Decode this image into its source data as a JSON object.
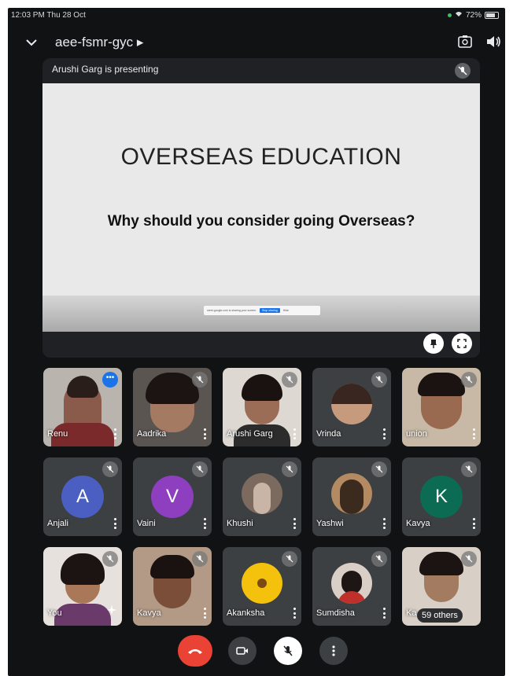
{
  "status": {
    "time": "12:03 PM  Thu 28 Oct",
    "battery": "72%"
  },
  "meeting": {
    "code": "aee-fsmr-gyc ▸"
  },
  "presentation": {
    "presenter_text": "Arushi Garg is presenting",
    "slide_title": "OVERSEAS  EDUCATION",
    "slide_subtitle": "Why should you consider going Overseas?",
    "share_bar": {
      "message": "meet.google.com is sharing your screen.",
      "stop_label": "Stop sharing",
      "hide_label": "Hide"
    }
  },
  "participants": [
    {
      "name": "Renu"
    },
    {
      "name": "Aadrika"
    },
    {
      "name": "Arushi Garg"
    },
    {
      "name": "Vrinda"
    },
    {
      "name": "union"
    },
    {
      "name": "Anjali",
      "initial": "A",
      "color": "#4a5fc1"
    },
    {
      "name": "Vaini",
      "initial": "V",
      "color": "#8e3fbf"
    },
    {
      "name": "Khushi"
    },
    {
      "name": "Yashwi"
    },
    {
      "name": "Kavya",
      "initial": "K",
      "color": "#0b6b53"
    },
    {
      "name": "You"
    },
    {
      "name": "Kavya"
    },
    {
      "name": "Akanksha"
    },
    {
      "name": "Sumdisha"
    },
    {
      "name": "Ka"
    }
  ],
  "others_label": "59 others",
  "colors": {
    "end_call": "#ea4335",
    "background": "#111214",
    "tile": "#3c4043"
  }
}
